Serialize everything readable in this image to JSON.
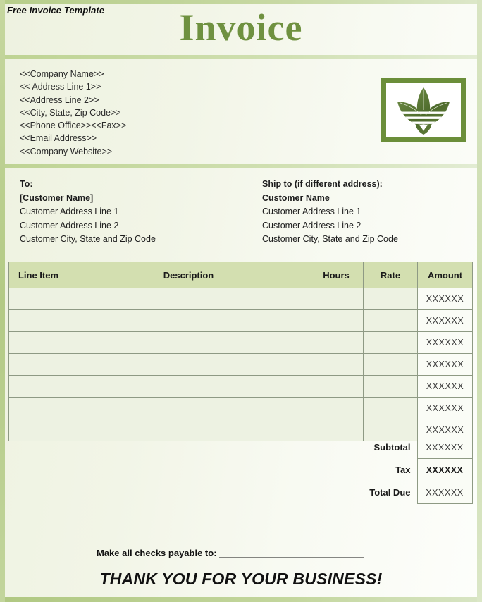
{
  "document": {
    "template_label": "Free Invoice Template",
    "title": "Invoice"
  },
  "theme": {
    "accent_green": "#6f9140",
    "border_green": "#b9cf8e",
    "table_header_green": "#d3dfb0",
    "logo_frame_green": "#6b8e3a",
    "cell_green": "#edf2e2"
  },
  "company": {
    "lines": [
      "<<Company Name>>",
      "<< Address Line 1>>",
      "<<Address Line 2>>",
      "<<City, State, Zip Code>>",
      "<<Phone Office>><<Fax>>",
      "<<Email Address>>",
      "<<Company Website>>"
    ]
  },
  "logo": {
    "name": "three-leaf-trefoil-logo"
  },
  "bill_to": {
    "heading": "To:",
    "customer_name": "[Customer Name]",
    "lines": [
      "Customer Address Line 1",
      "Customer Address Line 2",
      "Customer City, State and Zip Code"
    ]
  },
  "ship_to": {
    "heading": "Ship to (if different address):",
    "customer_name": "Customer Name",
    "lines": [
      "Customer Address Line 1",
      "Customer Address Line 2",
      "Customer City, State and Zip Code"
    ]
  },
  "items_table": {
    "columns": [
      "Line Item",
      "Description",
      "Hours",
      "Rate",
      "Amount"
    ],
    "rows": [
      {
        "line_item": "",
        "description": "",
        "hours": "",
        "rate": "",
        "amount": "XXXXXX"
      },
      {
        "line_item": "",
        "description": "",
        "hours": "",
        "rate": "",
        "amount": "XXXXXX"
      },
      {
        "line_item": "",
        "description": "",
        "hours": "",
        "rate": "",
        "amount": "XXXXXX"
      },
      {
        "line_item": "",
        "description": "",
        "hours": "",
        "rate": "",
        "amount": "XXXXXX"
      },
      {
        "line_item": "",
        "description": "",
        "hours": "",
        "rate": "",
        "amount": "XXXXXX"
      },
      {
        "line_item": "",
        "description": "",
        "hours": "",
        "rate": "",
        "amount": "XXXXXX"
      },
      {
        "line_item": "",
        "description": "",
        "hours": "",
        "rate": "",
        "amount": "XXXXXX"
      }
    ]
  },
  "totals": {
    "subtotal_label": "Subtotal",
    "subtotal_value": "XXXXXX",
    "tax_label": "Tax",
    "tax_value": "XXXXXX",
    "total_due_label": "Total Due",
    "total_due_value": "XXXXXX"
  },
  "footer": {
    "payable_label": "Make all checks payable to:",
    "payable_rule": "______________________________",
    "thanks": "THANK YOU FOR YOUR BUSINESS!"
  }
}
